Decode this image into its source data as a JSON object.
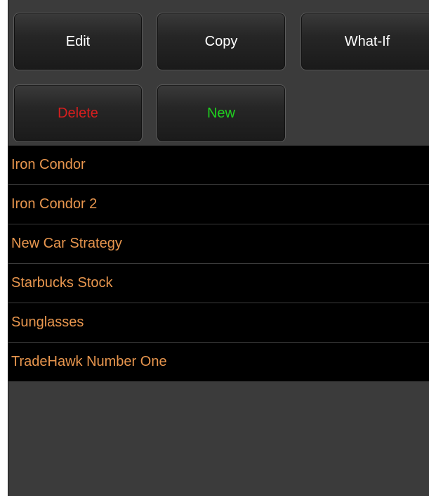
{
  "toolbar": {
    "edit_label": "Edit",
    "copy_label": "Copy",
    "whatif_label": "What-If",
    "delete_label": "Delete",
    "new_label": "New"
  },
  "colors": {
    "item_text": "#e8964e",
    "delete_text": "#d81e1e",
    "new_text": "#1fd01f",
    "button_text": "#ffffff",
    "panel_bg": "#3b3b3b",
    "list_bg": "#000000"
  },
  "strategies": {
    "items": [
      {
        "label": "Iron Condor"
      },
      {
        "label": "Iron Condor 2"
      },
      {
        "label": "New Car Strategy"
      },
      {
        "label": "Starbucks Stock"
      },
      {
        "label": "Sunglasses"
      },
      {
        "label": "TradeHawk Number One"
      }
    ]
  }
}
